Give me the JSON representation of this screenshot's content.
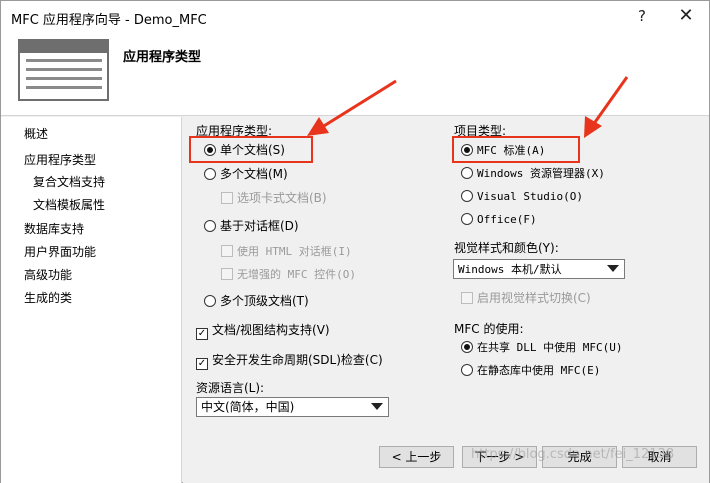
{
  "window": {
    "title": "MFC 应用程序向导 - Demo_MFC",
    "help_glyph": "?",
    "close_glyph": "✕"
  },
  "header": {
    "title": "应用程序类型",
    "icon": "window-icon"
  },
  "nav": {
    "items": [
      {
        "label": "概述"
      },
      {
        "label": "应用程序类型"
      },
      {
        "label": "复合文档支持"
      },
      {
        "label": "文档模板属性"
      },
      {
        "label": "数据库支持"
      },
      {
        "label": "用户界面功能"
      },
      {
        "label": "高级功能"
      },
      {
        "label": "生成的类"
      }
    ]
  },
  "app_type": {
    "label": "应用程序类型:",
    "single_doc": "单个文档(S)",
    "multi_doc": "多个文档(M)",
    "tabbed_docs": "选项卡式文档(B)",
    "dialog_based": "基于对话框(D)",
    "use_html_dialog": "使用 HTML 对话框(I)",
    "no_enhanced_mfc": "无增强的 MFC 控件(O)",
    "multi_top_level": "多个顶级文档(T)",
    "doc_view": "文档/视图结构支持(V)",
    "sdl": "安全开发生命周期(SDL)检查(C)",
    "selected": "single_doc"
  },
  "resource_lang": {
    "label": "资源语言(L):",
    "value": "中文(简体，中国)"
  },
  "project_type": {
    "label": "项目类型:",
    "mfc_standard": "MFC 标准(A)",
    "windows_explorer": "Windows 资源管理器(X)",
    "visual_studio": "Visual Studio(O)",
    "office": "Office(F)",
    "selected": "mfc_standard"
  },
  "visual_style": {
    "label": "视觉样式和颜色(Y):",
    "value": "Windows 本机/默认",
    "enable_switch": "启用视觉样式切换(C)"
  },
  "mfc_use": {
    "label": "MFC 的使用:",
    "shared_dll": "在共享 DLL 中使用 MFC(U)",
    "static_lib": "在静态库中使用 MFC(E)",
    "selected": "shared_dll"
  },
  "buttons": {
    "prev": "< 上一步",
    "next": "下一步 >",
    "finish": "完成",
    "cancel": "取消"
  },
  "watermark": "https://blog.csdn.net/fei_12138",
  "colors": {
    "annotation_red": "#e8341c",
    "window_bg": "#f0f0f0"
  }
}
